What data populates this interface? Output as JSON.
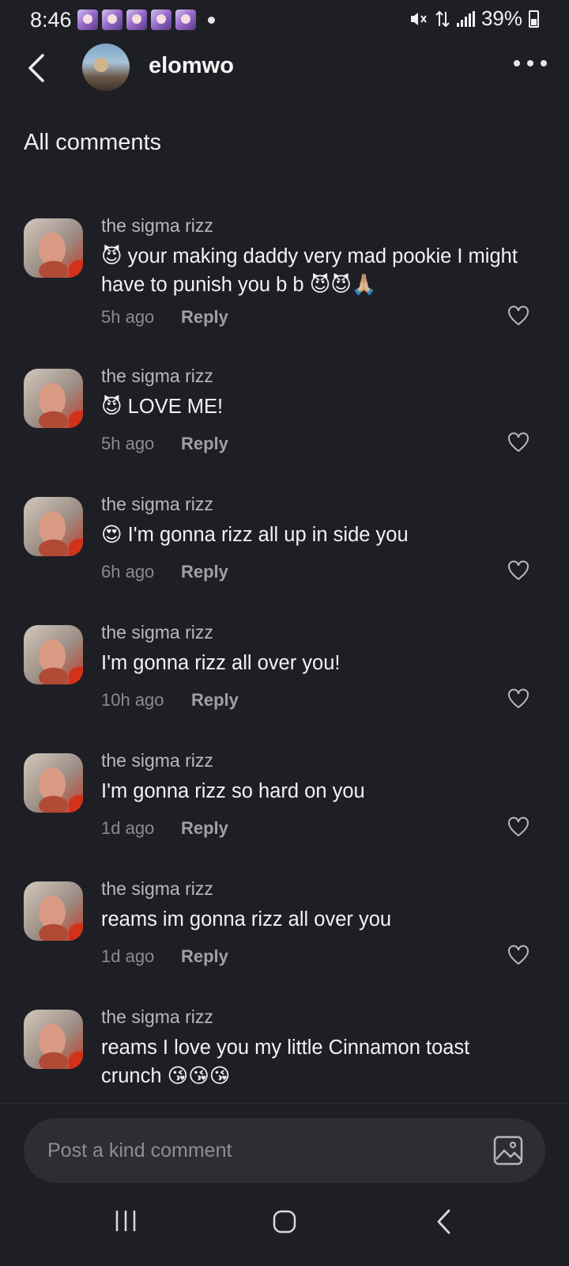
{
  "status_bar": {
    "time": "8:46",
    "battery": "39%",
    "notification_count": 5
  },
  "header": {
    "username": "elomwo",
    "back_icon": "chevron-left-icon",
    "more_icon": "more-horizontal-icon"
  },
  "section_title": "All comments",
  "reply_label": "Reply",
  "comments": [
    {
      "author": "the sigma rizz",
      "text": "😈 your making daddy very mad pookie I might have to punish you b b 😈😈🙏🏼",
      "time": "5h ago"
    },
    {
      "author": "the sigma rizz",
      "text": "😈 LOVE ME!",
      "time": "5h ago"
    },
    {
      "author": "the sigma rizz",
      "text": "😍 I'm gonna rizz all up in side you",
      "time": "6h ago"
    },
    {
      "author": "the sigma rizz",
      "text": "I'm gonna rizz all over you!",
      "time": "10h ago"
    },
    {
      "author": "the sigma rizz",
      "text": "I'm gonna rizz so hard on you",
      "time": "1d ago"
    },
    {
      "author": "the sigma rizz",
      "text": "reams im gonna rizz all over you",
      "time": "1d ago"
    },
    {
      "author": "the sigma rizz",
      "text": "reams I love you my little Cinnamon toast crunch 😘😘😘",
      "time": ""
    }
  ],
  "input": {
    "placeholder": "Post a kind comment",
    "image_icon": "image-icon"
  },
  "colors": {
    "background": "#1e1f24",
    "input_background": "#2d2e33",
    "text_primary": "#f2f2f2",
    "text_secondary": "#8a8b90"
  }
}
